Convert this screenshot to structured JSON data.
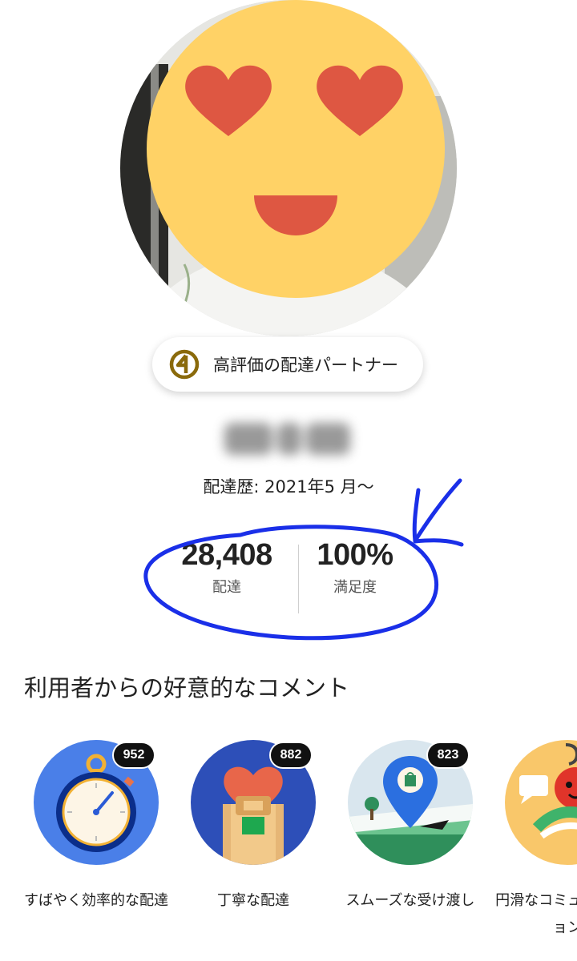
{
  "profile": {
    "badge_label": "高評価の配達パートナー",
    "history": "配達歴: 2021年5 月〜"
  },
  "stats": [
    {
      "value": "28,408",
      "label": "配達"
    },
    {
      "value": "100%",
      "label": "満足度"
    }
  ],
  "compliments": {
    "title": "利用者からの好意的なコメント",
    "items": [
      {
        "label": "すばやく効率的な配達",
        "count": "952",
        "icon": "stopwatch-icon"
      },
      {
        "label": "丁寧な配達",
        "count": "882",
        "icon": "heart-package-icon"
      },
      {
        "label": "スムーズな受け渡し",
        "count": "823",
        "icon": "location-pin-icon"
      },
      {
        "label": "円滑なコミュニケーション",
        "count": "",
        "icon": "tomato-chat-icon"
      }
    ]
  },
  "colors": {
    "emoji_yellow": "#FFD266",
    "emoji_red": "#DE5742",
    "annotation_blue": "#1A2FE8",
    "badge_gold": "#8A6A0B"
  }
}
